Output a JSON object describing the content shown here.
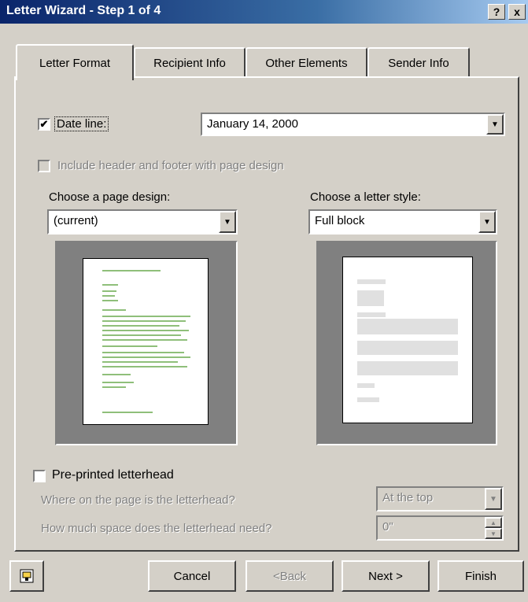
{
  "window": {
    "title": "Letter Wizard - Step 1 of 4",
    "help_label": "?",
    "close_label": "x"
  },
  "tabs": [
    {
      "label": "Letter Format",
      "active": true
    },
    {
      "label": "Recipient Info",
      "active": false
    },
    {
      "label": "Other Elements",
      "active": false
    },
    {
      "label": "Sender Info",
      "active": false
    }
  ],
  "date_line": {
    "checked": true,
    "check_mark": "✔",
    "label": "Date line:",
    "value": "January 14, 2000"
  },
  "header_footer": {
    "checked": false,
    "enabled": false,
    "label": "Include header and footer with page design"
  },
  "page_design": {
    "label": "Choose a page design:",
    "value": "(current)"
  },
  "letter_style": {
    "label": "Choose a letter style:",
    "value": "Full block"
  },
  "letterhead": {
    "checked": false,
    "label": "Pre-printed letterhead",
    "where_label": "Where on the page is the letterhead?",
    "where_value": "At the top",
    "space_label": "How much space does the letterhead need?",
    "space_value": "0\""
  },
  "buttons": {
    "cancel": "Cancel",
    "back": "<Back",
    "next": "Next >",
    "finish": "Finish"
  },
  "colors": {
    "title_bar": "#0a246a",
    "face": "#d4d0c8",
    "preview_bg": "#808080"
  }
}
